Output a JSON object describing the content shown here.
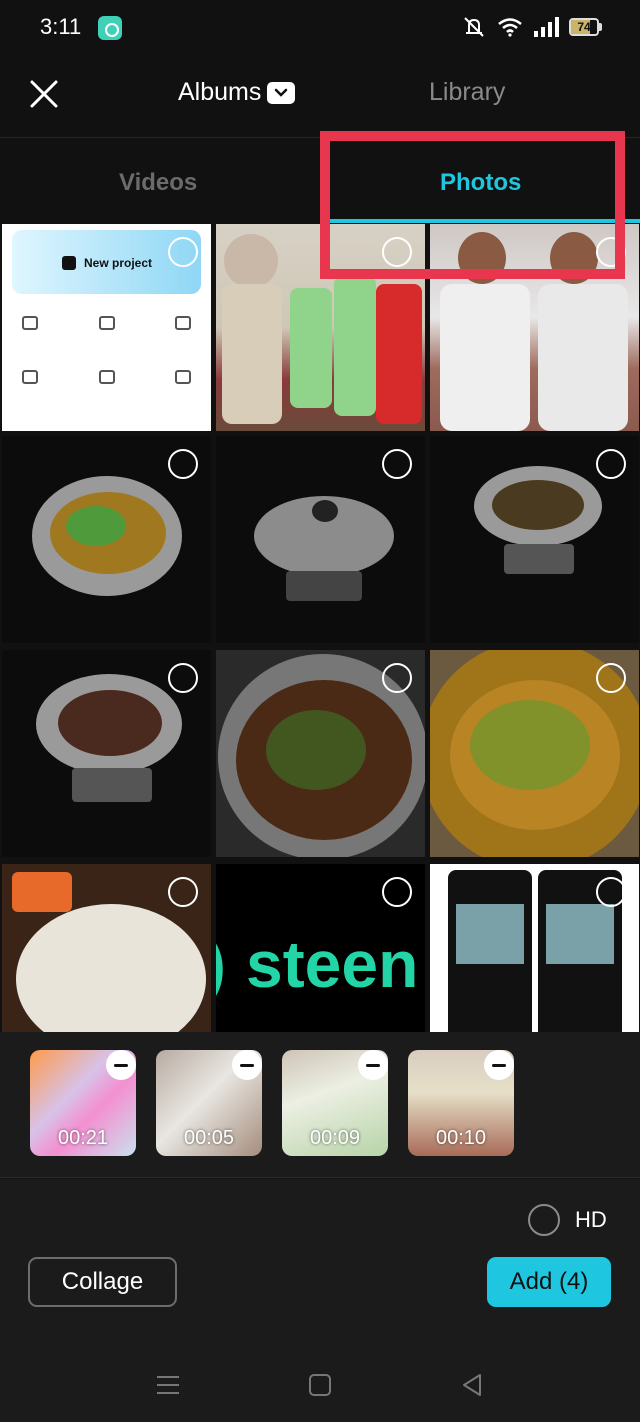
{
  "status_bar": {
    "time": "3:11",
    "battery": "74",
    "battery_level": 0.74,
    "icons": [
      "app-notification-icon",
      "mute-icon",
      "wifi-icon",
      "signal-icon",
      "battery-icon"
    ]
  },
  "header": {
    "albums_label": "Albums",
    "library_label": "Library"
  },
  "tabs": {
    "videos_label": "Videos",
    "photos_label": "Photos",
    "active": "Photos",
    "accent_color": "#1fc6e0",
    "highlight_color": "#e9364f"
  },
  "grid": {
    "items": [
      {
        "kind": "app-screenshot",
        "banner_text": "New project"
      },
      {
        "kind": "family-photo"
      },
      {
        "kind": "boys-photo"
      },
      {
        "kind": "cooking-pot"
      },
      {
        "kind": "covered-pot"
      },
      {
        "kind": "pot-on-stove"
      },
      {
        "kind": "dark-curry-pot"
      },
      {
        "kind": "pan-with-curry"
      },
      {
        "kind": "curry-closeup"
      },
      {
        "kind": "plated-food"
      },
      {
        "kind": "steem-logo",
        "text": "steen"
      },
      {
        "kind": "app-screenshots"
      }
    ]
  },
  "selected": [
    {
      "duration": "00:21"
    },
    {
      "duration": "00:05"
    },
    {
      "duration": "00:09"
    },
    {
      "duration": "00:10"
    }
  ],
  "controls": {
    "hd_label": "HD",
    "collage_label": "Collage",
    "add_label": "Add (4)"
  },
  "nav": {
    "icons": [
      "recents-icon",
      "home-icon",
      "back-icon"
    ]
  }
}
